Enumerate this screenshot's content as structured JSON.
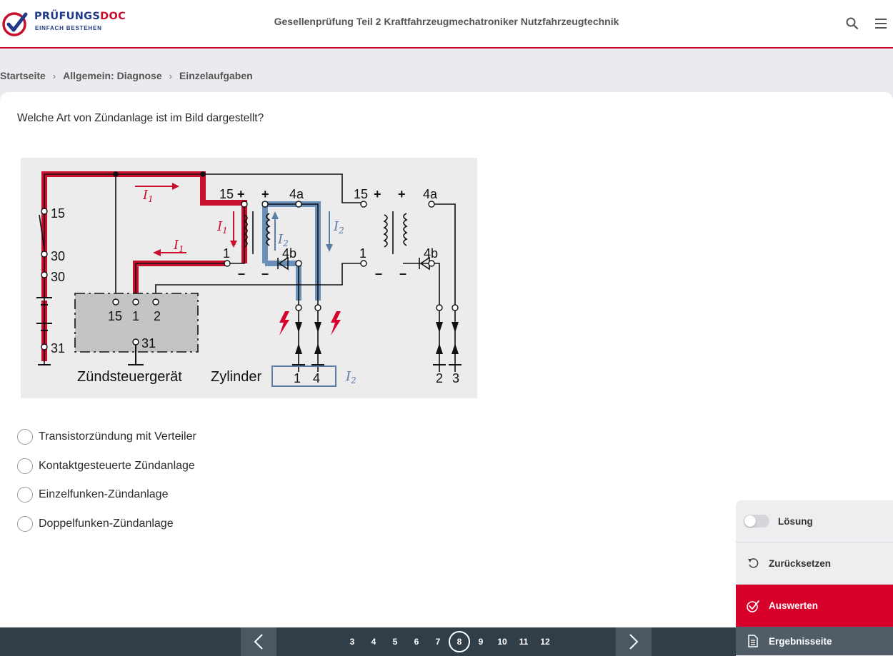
{
  "brand": {
    "name_part1": "PRÜFUNGS",
    "name_part2": "DOC",
    "tagline": "EINFACH BESTEHEN",
    "logo_icon": "check-circle-logo-icon"
  },
  "header": {
    "title": "Gesellenprüfung Teil 2 Kraftfahrzeugmechatroniker Nutzfahrzeugtechnik",
    "search_icon": "search-icon",
    "menu_icon": "hamburger-menu-icon"
  },
  "breadcrumb": [
    {
      "label": "Startseite"
    },
    {
      "label": "Allgemein: Diagnose"
    },
    {
      "label": "Einzelaufgaben"
    }
  ],
  "question": {
    "text": "Welche Art von Zündanlage ist im Bild dargestellt?",
    "figure": {
      "labels": {
        "t15": "15",
        "t30": "30",
        "t31": "31",
        "i1": "I",
        "sub1": "1",
        "i2": "I",
        "sub2": "2",
        "plus": "+",
        "minus": "–",
        "t4a": "4a",
        "t4b": "4b",
        "t1": "1",
        "t2": "2",
        "c1": "1",
        "c4": "4",
        "c2": "2",
        "c3": "3",
        "ecu": "Zündsteuergerät",
        "cylinder": "Zylinder"
      }
    }
  },
  "answers": [
    {
      "label": "Transistorzündung mit Verteiler",
      "selected": false
    },
    {
      "label": "Kontaktgesteuerte Zündanlage",
      "selected": false
    },
    {
      "label": "Einzelfunken-Zündanlage",
      "selected": false
    },
    {
      "label": "Doppelfunken-Zündanlage",
      "selected": false
    }
  ],
  "side_panel": {
    "solution_label": "Lösung",
    "solution_on": false,
    "reset_label": "Zurücksetzen",
    "evaluate_label": "Auswerten",
    "results_label": "Ergebnisseite"
  },
  "pagination": {
    "pages": [
      "3",
      "4",
      "5",
      "6",
      "7",
      "8",
      "9",
      "10",
      "11",
      "12"
    ],
    "current": "8"
  },
  "colors": {
    "brand_red": "#c8102e",
    "brand_blue": "#1f3a8a",
    "evaluate_bg": "#d6002b",
    "footer_bg": "#313d47",
    "current_wire": "#c8102e",
    "secondary_wire": "#5a7ea6"
  }
}
